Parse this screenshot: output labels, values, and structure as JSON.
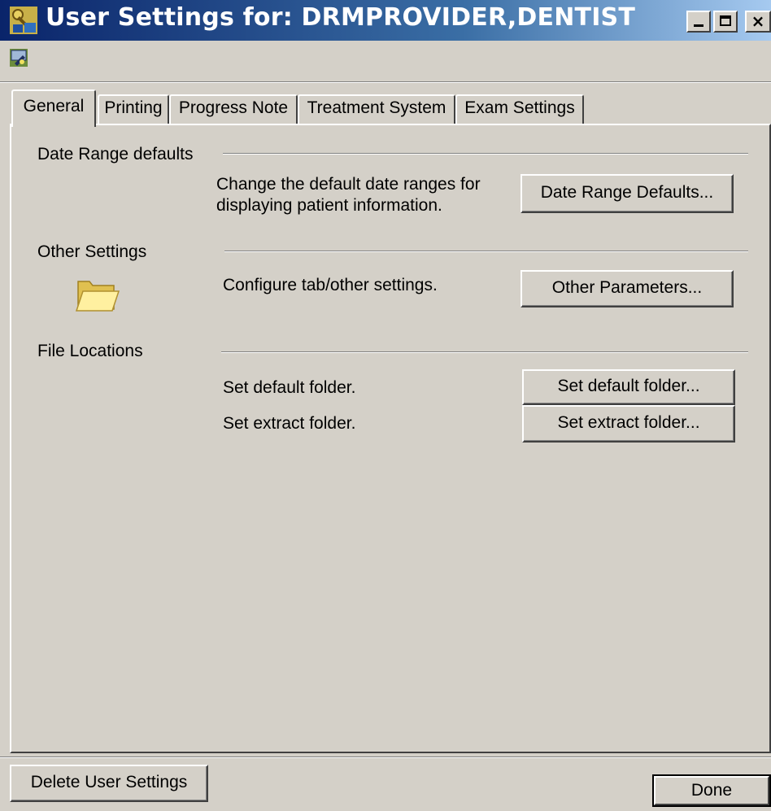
{
  "window": {
    "title": "User Settings for: DRMPROVIDER,DENTIST",
    "icon": "keys-icon",
    "controls": {
      "minimize": "minimize-icon",
      "maximize": "maximize-icon",
      "close": "×"
    }
  },
  "toolbar": {
    "icon": "user-settings-icon"
  },
  "tabs": [
    {
      "label": "General",
      "active": true
    },
    {
      "label": "Printing",
      "active": false
    },
    {
      "label": "Progress Note",
      "active": false
    },
    {
      "label": "Treatment System",
      "active": false
    },
    {
      "label": "Exam Settings",
      "active": false
    }
  ],
  "sections": {
    "date_range": {
      "heading": "Date Range defaults",
      "desc_line1": "Change the default date ranges for",
      "desc_line2": "displaying patient information.",
      "button": "Date Range Defaults..."
    },
    "other": {
      "heading": "Other Settings",
      "icon": "folder-icon",
      "desc": "Configure tab/other settings.",
      "button": "Other Parameters..."
    },
    "files": {
      "heading": "File Locations",
      "default_desc": "Set default folder.",
      "default_button": "Set default folder...",
      "extract_desc": "Set extract folder.",
      "extract_button": "Set extract folder..."
    }
  },
  "footer": {
    "delete_button": "Delete User Settings",
    "done_button": "Done"
  },
  "colors": {
    "face": "#d4d0c8",
    "title_start": "#0a246a",
    "title_end": "#a6caf0"
  }
}
